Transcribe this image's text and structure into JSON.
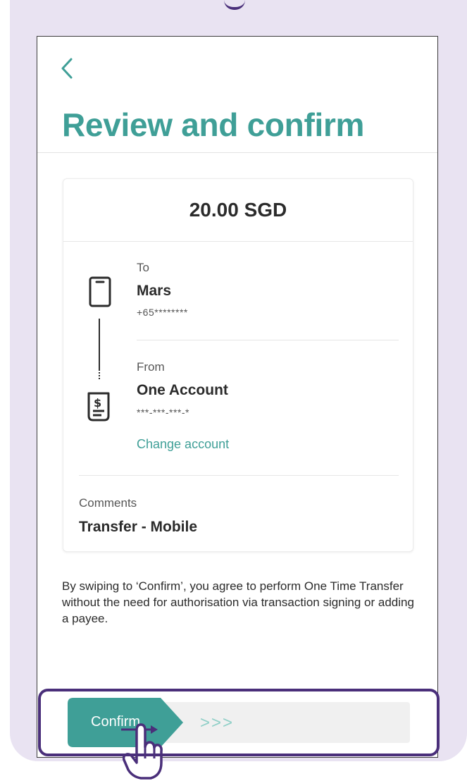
{
  "header": {
    "back_icon": "chevron-left-icon",
    "title": "Review and confirm"
  },
  "transfer": {
    "amount": "20.00 SGD",
    "to": {
      "label": "To",
      "name": "Mars",
      "number": "+65********",
      "icon": "mobile-phone-icon"
    },
    "from": {
      "label": "From",
      "name": "One Account",
      "number": "***-***-***-*",
      "icon": "account-statement-icon",
      "change_label": "Change account"
    },
    "comments": {
      "label": "Comments",
      "value": "Transfer - Mobile"
    }
  },
  "disclaimer": "By swiping to ‘Confirm’, you agree to perform One Time Transfer without the need for authorisation via transaction signing or adding a payee.",
  "slider": {
    "label": "Confirm",
    "chevrons": ">>>",
    "hint_icon": "swipe-hand-icon"
  },
  "colors": {
    "accent": "#3f9f97",
    "frame": "#e9e3f2",
    "highlight": "#4a2f7a",
    "text": "#2b2b2b"
  }
}
